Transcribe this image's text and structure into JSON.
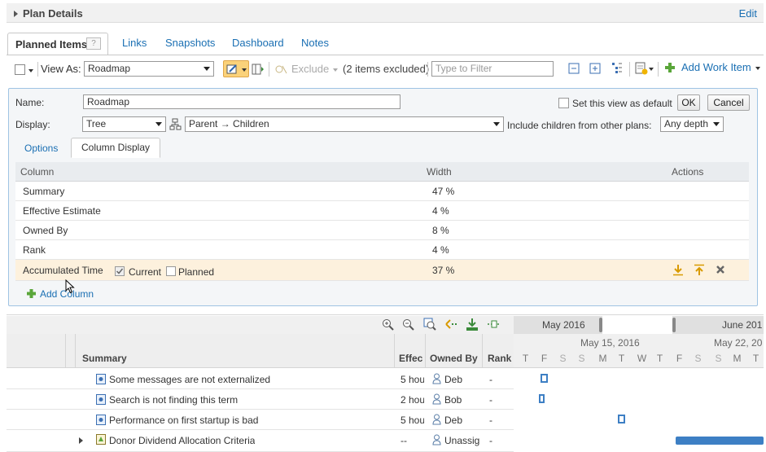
{
  "plan_details": {
    "title": "Plan Details",
    "edit": "Edit"
  },
  "tabs": {
    "planned_items": "Planned Items",
    "help": "?",
    "links": "Links",
    "snapshots": "Snapshots",
    "dashboard": "Dashboard",
    "notes": "Notes"
  },
  "toolbar": {
    "view_as_label": "View As:",
    "view_as_value": "Roadmap",
    "exclude": "Exclude",
    "excluded_count": "(2 items excluded)",
    "filter_placeholder": "Type to Filter",
    "add_work_item": "Add Work Item"
  },
  "view_options": {
    "name_label": "Name:",
    "name_value": "Roadmap",
    "set_default": "Set this view as default",
    "ok": "OK",
    "cancel": "Cancel",
    "display_label": "Display:",
    "display_value": "Tree",
    "relationship_value": "Parent → Children",
    "include_children_label": "Include children from other plans:",
    "depth_value": "Any depth",
    "subtabs": {
      "options": "Options",
      "column_display": "Column Display"
    },
    "columns_header": {
      "column": "Column",
      "width": "Width",
      "actions": "Actions"
    },
    "columns": [
      {
        "name": "Summary",
        "width": "47 %"
      },
      {
        "name": "Effective Estimate",
        "width": "4 %"
      },
      {
        "name": "Owned By",
        "width": "8 %"
      },
      {
        "name": "Rank",
        "width": "4 %"
      }
    ],
    "selected_column": {
      "name": "Accumulated Time",
      "current": "Current",
      "planned": "Planned",
      "width": "37 %"
    },
    "add_column": "Add Column"
  },
  "gantt": {
    "months": [
      "May 2016",
      "June 201"
    ],
    "weeks": [
      "May 15, 2016",
      "May 22, 20"
    ],
    "days": [
      "T",
      "F",
      "S",
      "S",
      "M",
      "T",
      "W",
      "T",
      "F",
      "S",
      "S",
      "M",
      "T"
    ],
    "headers": {
      "summary": "Summary",
      "effective": "Effec",
      "owned_by": "Owned By",
      "rank": "Rank"
    },
    "rows": [
      {
        "summary": "Some messages are not externalized",
        "estimate": "5 hou",
        "owner": "Deb",
        "rank": "-"
      },
      {
        "summary": "Search is not finding this term",
        "estimate": "2 hou",
        "owner": "Bob",
        "rank": "-"
      },
      {
        "summary": "Performance on first startup is bad",
        "estimate": "5 hou",
        "owner": "Deb",
        "rank": "-"
      },
      {
        "summary": "Donor Dividend Allocation Criteria",
        "estimate": "--",
        "owner": "Unassig",
        "rank": "-"
      }
    ]
  },
  "colors": {
    "accent_link": "#1a6fb3",
    "selected_row": "#fdf1dd",
    "panel_border": "#9fc3e3",
    "milestone": "#3d7fc4"
  }
}
